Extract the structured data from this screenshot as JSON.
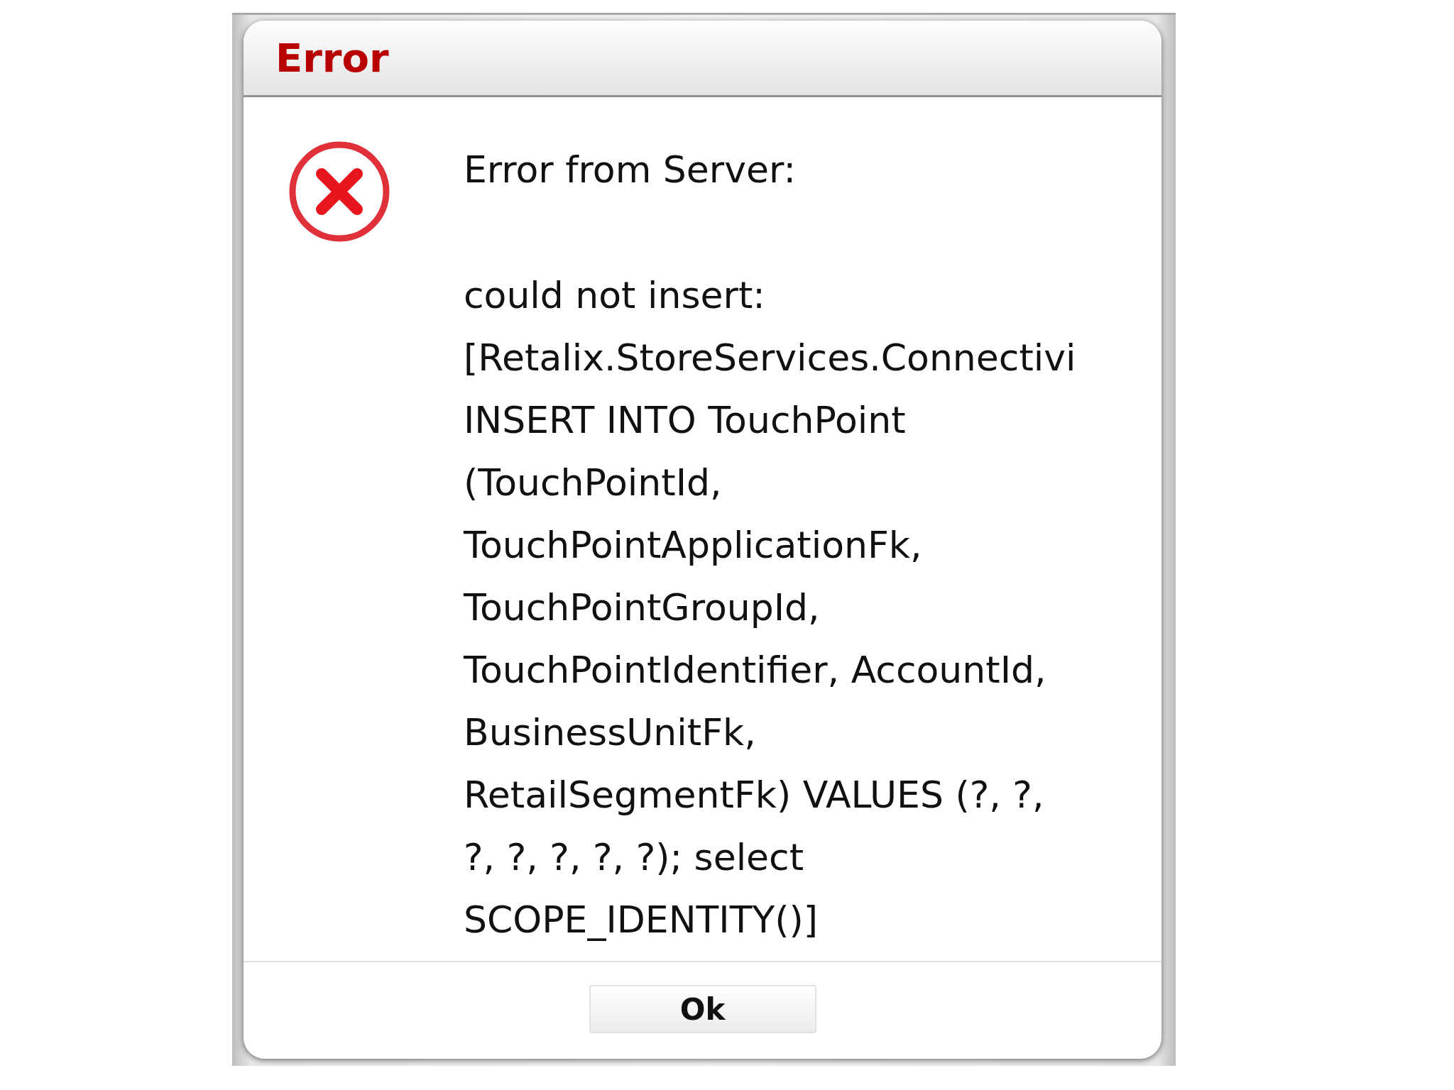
{
  "dialog": {
    "title": "Error",
    "heading": "Error from Server:",
    "lines": [
      "could not insert:",
      "[Retalix.StoreServices.Connectivi",
      "INSERT INTO TouchPoint",
      "(TouchPointId,",
      "TouchPointApplicationFk,",
      "TouchPointGroupId,",
      "TouchPointIdentifier, AccountId,",
      "BusinessUnitFk,",
      "RetailSegmentFk) VALUES (?, ?,",
      "?, ?, ?, ?, ?); select",
      "SCOPE_IDENTITY()]"
    ],
    "buttons": [
      "Ok"
    ]
  }
}
